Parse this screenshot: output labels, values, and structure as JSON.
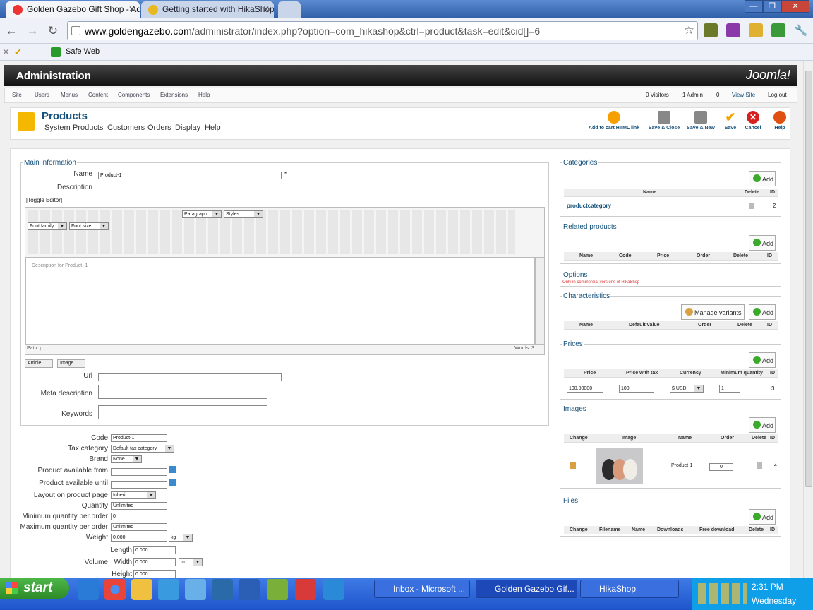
{
  "browser": {
    "tabs": [
      {
        "label": "Golden Gazebo Gift Shop - Ad",
        "active": true
      },
      {
        "label": "Getting started with HikaShop",
        "active": false
      }
    ],
    "url_host": "www.goldengazebo.com",
    "url_path": "/administrator/index.php?option=com_hikashop&ctrl=product&task=edit&cid[]=6",
    "bookmark_label": "Safe Web"
  },
  "admin": {
    "title": "Administration",
    "brand": "Joomla!",
    "menu": [
      "Site",
      "Users",
      "Menus",
      "Content",
      "Components",
      "Extensions",
      "Help"
    ],
    "status": [
      "0 Visitors",
      "1 Admin",
      "0",
      "View Site",
      "Log out"
    ]
  },
  "header": {
    "title": "Products",
    "submenu": [
      "System",
      "Products",
      "Customers",
      "Orders",
      "Display",
      "Help"
    ],
    "toolbar": [
      {
        "label": "Add to cart HTML link",
        "icon": "add-to-cart-icon",
        "color": "#f5a000"
      },
      {
        "label": "Save & Close",
        "icon": "save-close-icon",
        "color": "#666666"
      },
      {
        "label": "Save & New",
        "icon": "save-new-icon",
        "color": "#666666"
      },
      {
        "label": "Save",
        "icon": "checkmark-icon",
        "color": "#f0a800"
      },
      {
        "label": "Cancel",
        "icon": "cancel-icon",
        "color": "#d82020"
      },
      {
        "label": "Help",
        "icon": "help-icon",
        "color": "#e05010"
      }
    ]
  },
  "main_info": {
    "legend": "Main information",
    "name_label": "Name",
    "name_value": "Product-1",
    "required_mark": "*",
    "description_label": "Description",
    "toggle_editor": "[Toggle Editor]",
    "paragraph": "Paragraph",
    "styles": "Styles",
    "font_family": "Font family",
    "font_size": "Font size",
    "editor_text": "Description for Product -1",
    "path": "Path: p",
    "words": "Words: 3",
    "article_button": "Article",
    "image_button": "Image",
    "url_label": "Url",
    "meta_label": "Meta description",
    "keywords_label": "Keywords"
  },
  "fields": {
    "code_label": "Code",
    "code_value": "Product-1",
    "tax_label": "Tax category",
    "tax_value": "Default tax category",
    "brand_label": "Brand",
    "brand_value": "None",
    "avail_from_label": "Product available from",
    "avail_until_label": "Product available until",
    "layout_label": "Layout on product page",
    "layout_value": "Inherit",
    "quantity_label": "Quantity",
    "quantity_value": "Unlimited",
    "min_qty_label": "Minimum quantity per order",
    "min_qty_value": "0",
    "max_qty_label": "Maximum quantity per order",
    "max_qty_value": "Unlimited",
    "weight_label": "Weight",
    "weight_value": "0.000",
    "weight_unit": "kg",
    "volume_label": "Volume",
    "length_label": "Length",
    "length_value": "0.000",
    "width_label": "Width",
    "width_value": "0.000",
    "dim_unit": "m",
    "height_label": "Height",
    "height_value": "0.000"
  },
  "categories": {
    "legend": "Categories",
    "add": "Add",
    "headers": [
      "Name",
      "Delete",
      "ID"
    ],
    "row": {
      "name": "productcategory",
      "id": "2"
    }
  },
  "related": {
    "legend": "Related products",
    "add": "Add",
    "headers": [
      "Name",
      "Code",
      "Price",
      "Order",
      "Delete",
      "ID"
    ]
  },
  "options": {
    "legend": "Options",
    "note": "Only in commercial versions of HikaShop"
  },
  "characteristics": {
    "legend": "Characteristics",
    "manage": "Manage variants",
    "add": "Add",
    "headers": [
      "Name",
      "Default value",
      "Order",
      "Delete",
      "ID"
    ]
  },
  "prices": {
    "legend": "Prices",
    "add": "Add",
    "headers": [
      "Price",
      "Price with tax",
      "Currency",
      "Minimum quantity",
      "ID"
    ],
    "row": {
      "price": "100.00000",
      "price_tax": "100",
      "currency": "$ USD",
      "min_qty": "1",
      "id": "3"
    }
  },
  "images": {
    "legend": "Images",
    "add": "Add",
    "headers": [
      "Change",
      "Image",
      "Name",
      "Order",
      "Delete",
      "ID"
    ],
    "row": {
      "name": "Product-1",
      "order": "0",
      "id": "4"
    }
  },
  "files": {
    "legend": "Files",
    "add": "Add",
    "headers": [
      "Change",
      "Filename",
      "Name",
      "Downloads",
      "Free download",
      "Delete",
      "ID"
    ]
  },
  "taskbar": {
    "start": "start",
    "tasks": [
      "Inbox - Microsoft ...",
      "Golden Gazebo Gif...",
      "HikaShop"
    ],
    "time": "2:31 PM",
    "day": "Wednesday"
  }
}
